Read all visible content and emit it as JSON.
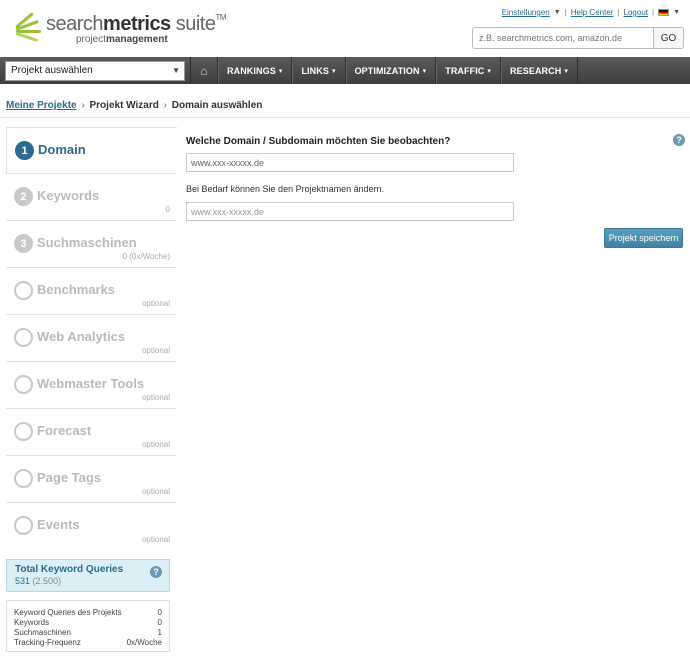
{
  "header": {
    "logo_prefix": "search",
    "logo_bold": "metrics",
    "logo_suffix": " suite",
    "logo_tm": "TM",
    "logo_sub_prefix": "project",
    "logo_sub_bold": "management",
    "links": {
      "settings": "Einstellungen",
      "help": "Help Center",
      "logout": "Logout"
    },
    "search_placeholder": "z.B. searchmetrics.com, amazon.de",
    "go_label": "GO"
  },
  "navbar": {
    "project_select": "Projekt auswählen",
    "items": [
      "RANKINGS",
      "LINKS",
      "OPTIMIZATION",
      "TRAFFIC",
      "RESEARCH"
    ]
  },
  "breadcrumb": {
    "item1": "Meine Projekte",
    "item2": "Projekt Wizard",
    "item3": "Domain auswählen"
  },
  "steps": [
    {
      "num": "1",
      "label": "Domain",
      "sub": ""
    },
    {
      "num": "2",
      "label": "Keywords",
      "sub": "0"
    },
    {
      "num": "3",
      "label": "Suchmaschinen",
      "sub": "0 (0x/Woche)"
    },
    {
      "num": "",
      "label": "Benchmarks",
      "sub": "optional"
    },
    {
      "num": "",
      "label": "Web Analytics",
      "sub": "optional"
    },
    {
      "num": "",
      "label": "Webmaster Tools",
      "sub": "optional"
    },
    {
      "num": "",
      "label": "Forecast",
      "sub": "optional"
    },
    {
      "num": "",
      "label": "Page Tags",
      "sub": "optional"
    },
    {
      "num": "",
      "label": "Events",
      "sub": "optional"
    }
  ],
  "keyword_queries": {
    "title": "Total Keyword Queries",
    "value": "531",
    "limit": "(2.500)"
  },
  "stats": [
    {
      "label": "Keyword Queries des Projekts",
      "value": "0"
    },
    {
      "label": "Keywords",
      "value": "0"
    },
    {
      "label": "Suchmaschinen",
      "value": "1"
    },
    {
      "label": "Tracking-Frequenz",
      "value": "0x/Woche"
    }
  ],
  "main": {
    "question": "Welche Domain / Subdomain möchten Sie beobachten?",
    "domain_value": "www.xxx-xxxxx.de",
    "project_name_hint": "Bei Bedarf können Sie den Projektnamen ändern.",
    "project_name_value": "www.xxx-xxxxx.de",
    "save_label": "Projekt speichern"
  },
  "colors": {
    "accent": "#2a6b8f",
    "nav_bg": "#4a4a4a",
    "logo_green": "#9bbf3a"
  }
}
